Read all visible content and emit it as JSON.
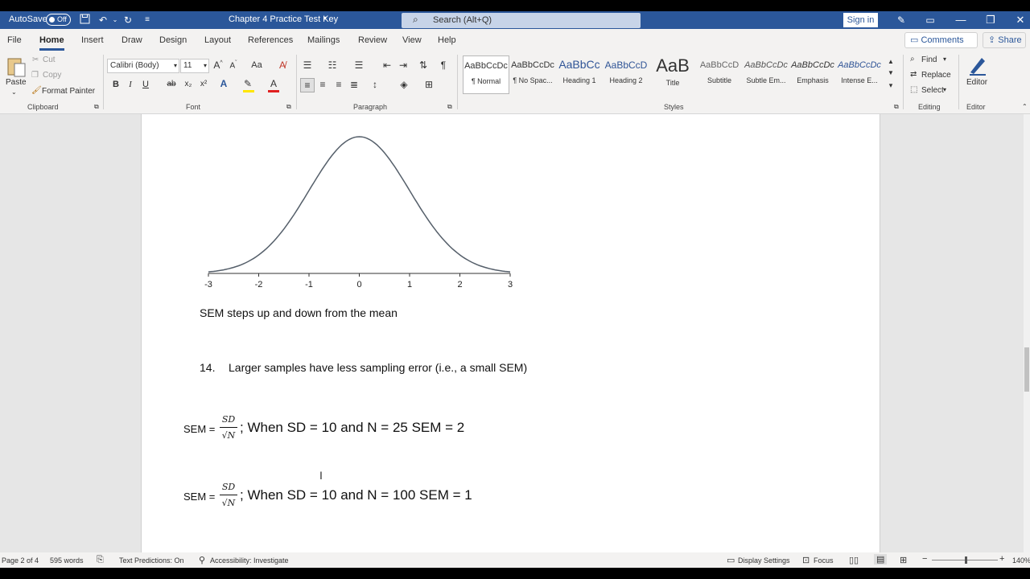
{
  "titlebar": {
    "autosave_label": "AutoSave",
    "autosave_state": "Off",
    "doc_title": "Chapter 4 Practice Test Key",
    "search_placeholder": "Search (Alt+Q)",
    "signin_label": "Sign in"
  },
  "menu": {
    "tabs": [
      "File",
      "Home",
      "Insert",
      "Draw",
      "Design",
      "Layout",
      "References",
      "Mailings",
      "Review",
      "View",
      "Help"
    ],
    "active_tab": "Home",
    "comments_label": "Comments",
    "share_label": "Share"
  },
  "ribbon": {
    "clipboard": {
      "paste": "Paste",
      "cut": "Cut",
      "copy": "Copy",
      "format_painter": "Format Painter",
      "label": "Clipboard"
    },
    "font": {
      "family": "Calibri (Body)",
      "size": "11",
      "label": "Font"
    },
    "paragraph": {
      "label": "Paragraph"
    },
    "styles": {
      "items": [
        {
          "preview": "AaBbCcDc",
          "name": "¶ Normal"
        },
        {
          "preview": "AaBbCcDc",
          "name": "¶ No Spac..."
        },
        {
          "preview": "AaBbCc",
          "name": "Heading 1"
        },
        {
          "preview": "AaBbCcD",
          "name": "Heading 2"
        },
        {
          "preview": "AaB",
          "name": "Title"
        },
        {
          "preview": "AaBbCcD",
          "name": "Subtitle"
        },
        {
          "preview": "AaBbCcDc",
          "name": "Subtle Em..."
        },
        {
          "preview": "AaBbCcDc",
          "name": "Emphasis"
        },
        {
          "preview": "AaBbCcDc",
          "name": "Intense E..."
        }
      ],
      "label": "Styles"
    },
    "editing": {
      "find": "Find",
      "replace": "Replace",
      "select": "Select",
      "label": "Editing"
    },
    "editor": {
      "button": "Editor",
      "label": "Editor"
    }
  },
  "document": {
    "chart_data": {
      "type": "line",
      "x_ticks": [
        "-3",
        "-2",
        "-1",
        "0",
        "1",
        "2",
        "3"
      ],
      "xlim": [
        -3,
        3
      ],
      "curve": "normal distribution, mean 0, sd 1"
    },
    "sem_line": "SEM steps up and down from the mean",
    "item_number": "14.",
    "item_text": "Larger samples have less sampling error (i.e., a small SEM)",
    "formula1": {
      "prefix": "SEM =",
      "numerator": "SD",
      "denominator": "√N",
      "text": "; When SD = 10 and N = 25 SEM = 2"
    },
    "formula2": {
      "prefix": "SEM =",
      "numerator": "SD",
      "denominator": "√N",
      "text": "; When SD = 10 and N = 100 SEM = 1"
    }
  },
  "statusbar": {
    "page": "Page 2 of 4",
    "words": "595 words",
    "text_predictions": "Text Predictions: On",
    "accessibility": "Accessibility: Investigate",
    "display_settings": "Display Settings",
    "focus": "Focus",
    "zoom": "140%"
  }
}
